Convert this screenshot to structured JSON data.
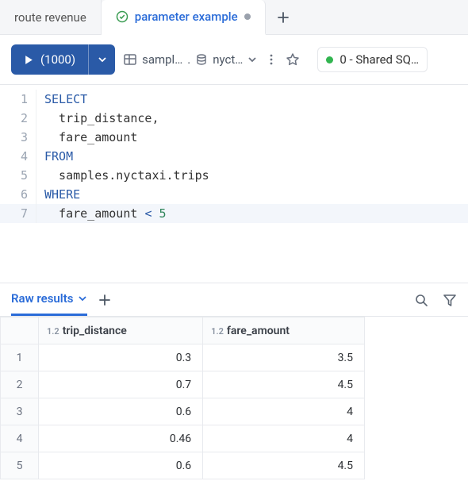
{
  "tabs": {
    "items": [
      {
        "label": "route revenue",
        "active": false
      },
      {
        "label": "parameter example",
        "active": true,
        "dirty": true,
        "status": "ok"
      }
    ]
  },
  "toolbar": {
    "run_label": "(1000)",
    "catalog_schema": "sampl…",
    "catalog_db": "nyct…",
    "cluster_label": "0 - Shared SQ…"
  },
  "editor": {
    "lines": [
      {
        "n": "1",
        "tokens": [
          {
            "t": "SELECT",
            "c": "kw"
          }
        ]
      },
      {
        "n": "2",
        "tokens": [
          {
            "t": "  trip_distance,",
            "c": ""
          }
        ]
      },
      {
        "n": "3",
        "tokens": [
          {
            "t": "  fare_amount",
            "c": ""
          }
        ]
      },
      {
        "n": "4",
        "tokens": [
          {
            "t": "FROM",
            "c": "kw"
          }
        ]
      },
      {
        "n": "5",
        "tokens": [
          {
            "t": "  samples.nyctaxi.trips",
            "c": ""
          }
        ]
      },
      {
        "n": "6",
        "tokens": [
          {
            "t": "WHERE",
            "c": "kw"
          }
        ]
      },
      {
        "n": "7",
        "tokens": [
          {
            "t": "  fare_amount ",
            "c": ""
          },
          {
            "t": "<",
            "c": "kw"
          },
          {
            "t": " ",
            "c": ""
          },
          {
            "t": "5",
            "c": "num"
          }
        ],
        "current": true
      }
    ]
  },
  "results": {
    "tab_label": "Raw results",
    "columns": [
      {
        "type_badge": "1.2",
        "name": "trip_distance"
      },
      {
        "type_badge": "1.2",
        "name": "fare_amount"
      }
    ],
    "rows": [
      {
        "n": "1",
        "v": [
          "0.3",
          "3.5"
        ]
      },
      {
        "n": "2",
        "v": [
          "0.7",
          "4.5"
        ]
      },
      {
        "n": "3",
        "v": [
          "0.6",
          "4"
        ]
      },
      {
        "n": "4",
        "v": [
          "0.46",
          "4"
        ]
      },
      {
        "n": "5",
        "v": [
          "0.6",
          "4.5"
        ]
      }
    ]
  },
  "chart_data": {
    "type": "table",
    "title": "Raw results",
    "columns": [
      "trip_distance",
      "fare_amount"
    ],
    "rows": [
      [
        0.3,
        3.5
      ],
      [
        0.7,
        4.5
      ],
      [
        0.6,
        4
      ],
      [
        0.46,
        4
      ],
      [
        0.6,
        4.5
      ]
    ]
  }
}
